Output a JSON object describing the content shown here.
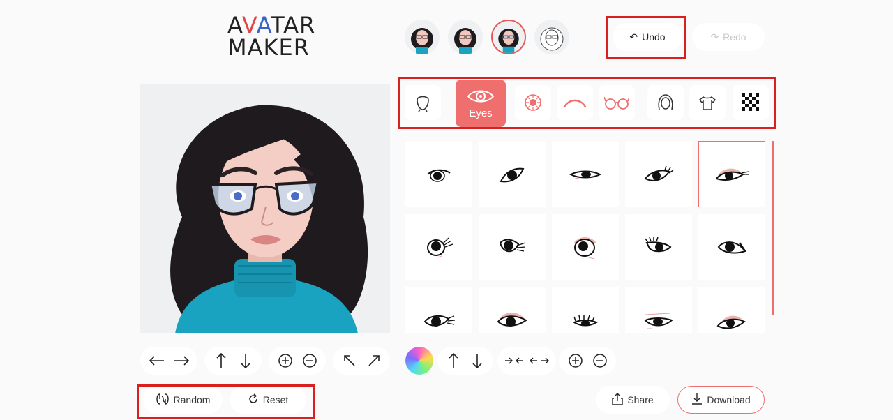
{
  "logo": {
    "line1_a": "A",
    "line1_v": "V",
    "line1_a2": "A",
    "line1_rest": "TAR",
    "line2": "MAKER"
  },
  "presets": [
    {
      "name": "preset-1"
    },
    {
      "name": "preset-2"
    },
    {
      "name": "preset-3",
      "selected": true
    },
    {
      "name": "preset-4"
    }
  ],
  "history": {
    "undo_label": "Undo",
    "redo_label": "Redo"
  },
  "tabs": [
    {
      "id": "face",
      "icon": "face-shape-icon"
    },
    {
      "id": "eyes",
      "icon": "eye-icon",
      "label": "Eyes",
      "active": true
    },
    {
      "id": "iris",
      "icon": "iris-icon"
    },
    {
      "id": "eyebrows",
      "icon": "eyebrow-icon"
    },
    {
      "id": "glasses",
      "icon": "glasses-icon"
    },
    {
      "id": "hair",
      "icon": "hair-icon"
    },
    {
      "id": "clothes",
      "icon": "shirt-icon"
    },
    {
      "id": "background",
      "icon": "checkerboard-icon"
    }
  ],
  "eye_options_selected_index": 4,
  "avatar_controls": [
    "arrow-left-icon",
    "arrow-right-icon",
    "arrow-up-icon",
    "arrow-down-icon",
    "zoom-in-icon",
    "zoom-out-icon",
    "rotate-left-icon",
    "rotate-right-icon"
  ],
  "feature_controls": [
    "color-picker",
    "arrow-up-icon",
    "arrow-down-icon",
    "spacing-narrow-icon",
    "spacing-wide-icon",
    "zoom-in-icon",
    "zoom-out-icon"
  ],
  "actions": {
    "random_label": "Random",
    "reset_label": "Reset",
    "share_label": "Share",
    "download_label": "Download"
  },
  "colors": {
    "accent": "#ef6f6f",
    "highlight_box": "#d9201f",
    "sweater": "#1aa3c0",
    "hair": "#1e1a1d"
  }
}
